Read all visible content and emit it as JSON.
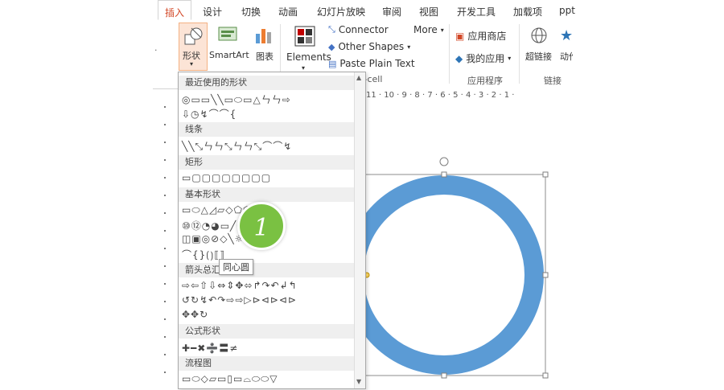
{
  "tabs": [
    "插入",
    "设计",
    "切换",
    "动画",
    "幻灯片放映",
    "审阅",
    "视图",
    "开发工具",
    "加载项",
    "ppt"
  ],
  "ribbon": {
    "shapes_label": "形状",
    "smartart_label": "SmartArt",
    "chart_label": "图表",
    "elements_label": "Elements",
    "connector_label": "Connector",
    "other_shapes_label": "Other Shapes",
    "paste_plain_text_label": "Paste Plain Text",
    "more_label": "More",
    "xcell_group_label": "x-cell",
    "app_store_label": "应用商店",
    "my_apps_label": "我的应用",
    "apps_group_label": "应用程序",
    "hyperlink_label": "超链接",
    "action_label": "动作",
    "links_group_label": "链接"
  },
  "ruler": {
    "text": "11 · 10 · 9 · 8 · 7 · 6 · 5 · 4 · 3 · 2 · 1 ·"
  },
  "shapes_menu": {
    "sections": [
      "最近使用的形状",
      "线条",
      "矩形",
      "基本形状",
      "箭头总汇",
      "公式形状",
      "流程图"
    ],
    "recent_row1": "◎▭▭╲╲▭⬭▭△ㄣㄣ⇨",
    "recent_row2": "⇩◷↯⌒⌒{",
    "lines_row": "╲╲⤡ㄣㄣ⤡ㄣㄣ⤡⌒⌒↯",
    "rect_row": "▭▢▢▢▢▢▢▢▢",
    "basic_row1": "▭⬭△◿▱◇⬠⬡⑦⑧",
    "basic_row2": "⑩⑫◔◕▭╱✚✚⌸",
    "basic_row3": "◫▣◎⊘◇╲☼☾☁",
    "basic_row4": "⌒{}⟮⟯⟦⟧",
    "arrows_row1": "⇨⇦⇧⇩⇔⇕✥⬄↱↷↶↲↰",
    "arrows_row2": "↺↻↯↶↷⇨⇨▷⊳⊲⊳⊲⊳",
    "arrows_row3": "✥✥↻",
    "equation_row": "✚━✖➗〓≠",
    "flowchart_row": "▭⬭◇▱▭▯▭⌓⬭⬭▽"
  },
  "tooltip": "同心圆",
  "badge": "1",
  "colors": {
    "accent": "#d24726",
    "ring": "#5b9bd5",
    "badge": "#7ac142"
  }
}
